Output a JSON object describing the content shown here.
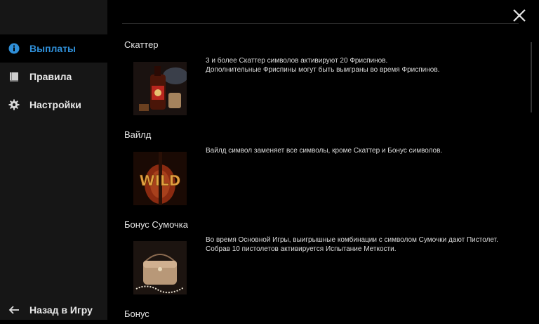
{
  "sidebar": {
    "items": [
      {
        "label": "Выплаты",
        "icon": "info-icon",
        "active": true
      },
      {
        "label": "Правила",
        "icon": "book-icon",
        "active": false
      },
      {
        "label": "Настройки",
        "icon": "gear-icon",
        "active": false
      }
    ],
    "back_label": "Назад в Игру",
    "accent": "#2f8fd8"
  },
  "sections": [
    {
      "title": "Скаттер",
      "lines": [
        "3 и более Скаттер символов активируют 20 Фриспинов.",
        "Дополнительные Фриспины могут быть выиграны во время Фриспинов."
      ],
      "image": "scatter-whiskey-image"
    },
    {
      "title": "Вайлд",
      "lines": [
        "Вайлд символ заменяет все символы, кроме Скаттер и Бонус символов."
      ],
      "image_text": "WILD",
      "image": "wild-violin-image"
    },
    {
      "title": "Бонус Сумочка",
      "lines": [
        "Во время Основной Игры, выигрышные комбинации с символом Сумочки дают Пистолет.",
        "Собрав 10 пистолетов активируется Испытание Меткости."
      ],
      "image": "bonus-purse-image"
    },
    {
      "title": "Бонус"
    }
  ]
}
